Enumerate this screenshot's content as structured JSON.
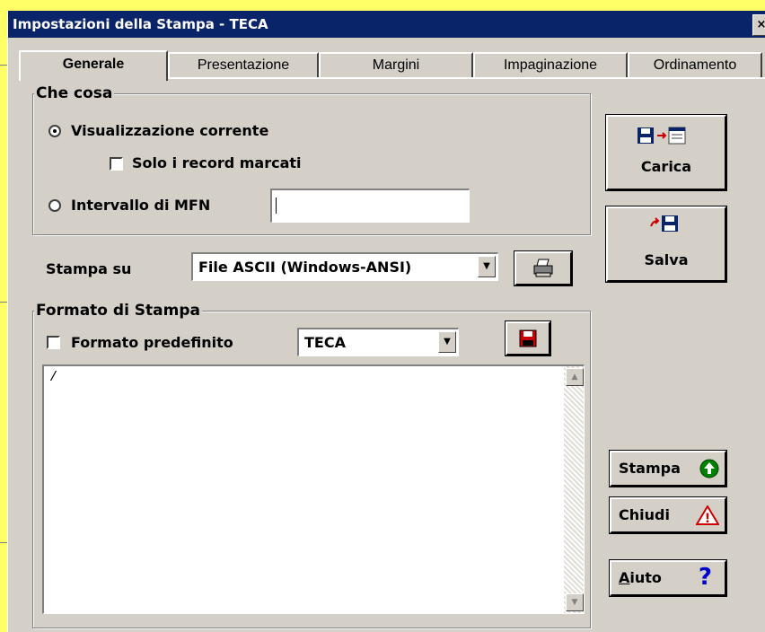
{
  "window": {
    "title": "Impostazioni della Stampa - TECA",
    "close_glyph": "×"
  },
  "tabs": [
    {
      "label": "Generale"
    },
    {
      "label": "Presentazione"
    },
    {
      "label": "Margini"
    },
    {
      "label": "Impaginazione"
    },
    {
      "label": "Ordinamento"
    }
  ],
  "what_group": {
    "legend": "Che cosa",
    "radio_current": "Visualizzazione corrente",
    "checkbox_marked": "Solo i record marcati",
    "radio_mfn": "Intervallo di MFN",
    "mfn_value": ""
  },
  "print_to": {
    "label": "Stampa su",
    "selected": "File ASCII (Windows-ANSI)"
  },
  "format_group": {
    "legend": "Formato di Stampa",
    "checkbox_default": "Formato predefinito",
    "format_selected": "TECA",
    "memo_text": "/"
  },
  "buttons": {
    "carica": "Carica",
    "salva": "Salva",
    "stampa": "Stampa",
    "chiudi": "Chiudi",
    "aiuto_underline": "A",
    "aiuto_rest": "iuto",
    "help_glyph": "?",
    "warning_glyph": "!"
  }
}
